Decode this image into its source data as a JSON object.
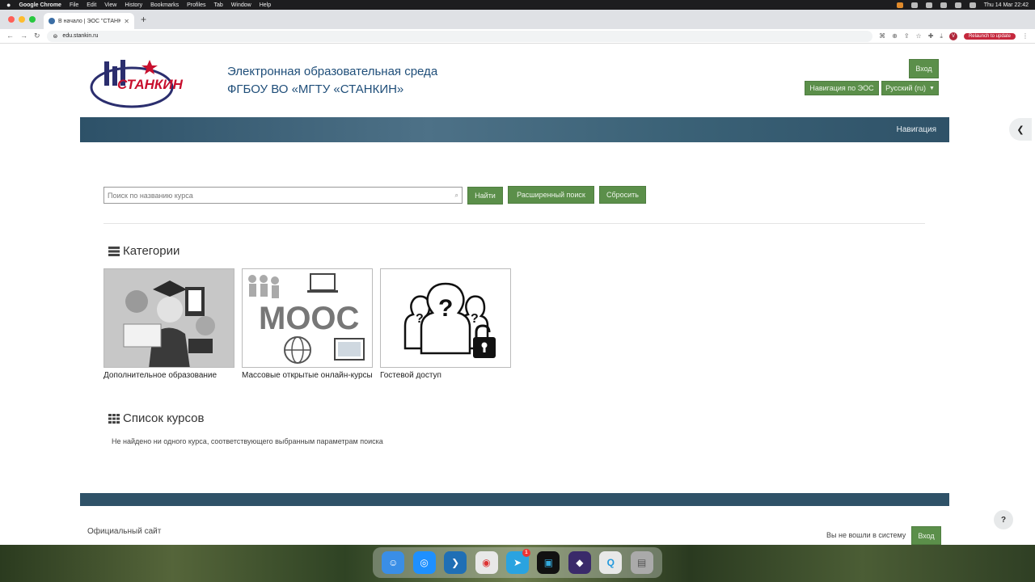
{
  "menubar": {
    "app": "Google Chrome",
    "items": [
      "File",
      "Edit",
      "View",
      "History",
      "Bookmarks",
      "Profiles",
      "Tab",
      "Window",
      "Help"
    ],
    "clock": "Thu 14 Mar  22:42"
  },
  "browser": {
    "tab_title": "В начало | ЭОС \"СТАНКИН\"",
    "url": "edu.stankin.ru",
    "relaunch": "Relaunch to update",
    "profile_initial": "V"
  },
  "header": {
    "logo_text": "СТАНКИН",
    "title_line1": "Электронная образовательная среда",
    "title_line2": "ФГБОУ ВО «МГТУ «СТАНКИН»",
    "login": "Вход",
    "nav_eos": "Навигация по ЭОС",
    "language": "Русский (ru)"
  },
  "banner": {
    "nav_label": "Навигация"
  },
  "search": {
    "placeholder": "Поиск по названию курса",
    "find": "Найти",
    "advanced": "Расширенный поиск",
    "reset": "Сбросить"
  },
  "categories": {
    "heading": "Категории",
    "items": [
      {
        "label": "Дополнительное образование"
      },
      {
        "label": "Массовые открытые онлайн-курсы",
        "image_text": "MOOC"
      },
      {
        "label": "Гостевой доступ"
      }
    ]
  },
  "courses": {
    "heading": "Список курсов",
    "empty": "Не найдено ни одного курса, соответствующего выбранным параметрам поиска"
  },
  "footer": {
    "official_site": "Официальный сайт",
    "not_logged": "Вы не вошли в систему",
    "login": "Вход"
  },
  "dock": {
    "telegram_badge": "1"
  },
  "colors": {
    "accent_green": "#5b8f4a",
    "banner_blue": "#2f5268",
    "title_blue": "#1f4e79"
  }
}
